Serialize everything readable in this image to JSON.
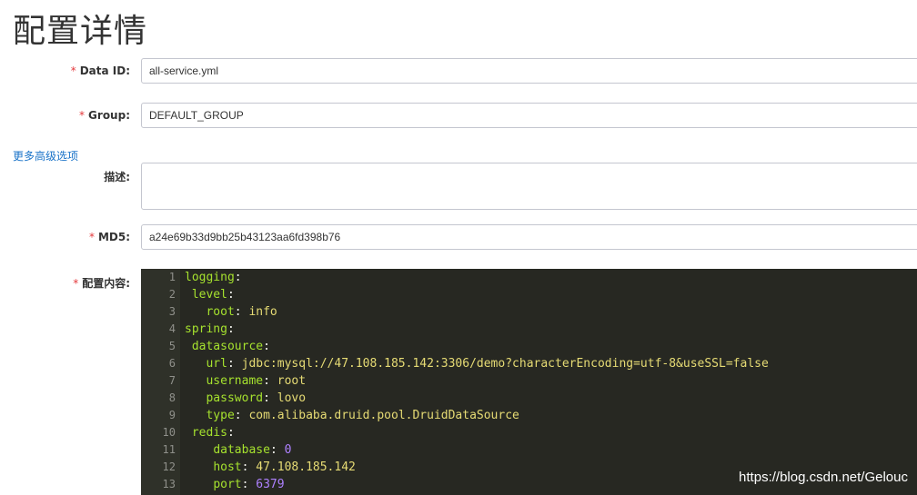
{
  "page": {
    "title": "配置详情"
  },
  "form": {
    "data_id": {
      "label": "Data ID:",
      "value": "all-service.yml"
    },
    "group": {
      "label": "Group:",
      "value": "DEFAULT_GROUP"
    },
    "advanced_link": "更多高级选项",
    "description": {
      "label": "描述:",
      "value": ""
    },
    "md5": {
      "label": "MD5:",
      "value": "a24e69b33d9bb25b43123aa6fd398b76"
    },
    "content": {
      "label": "配置内容:"
    },
    "required_mark": "*"
  },
  "editor": {
    "lines": [
      {
        "n": "1",
        "indent": "",
        "key": "logging",
        "value": "",
        "value_type": ""
      },
      {
        "n": "2",
        "indent": " ",
        "key": "level",
        "value": "",
        "value_type": ""
      },
      {
        "n": "3",
        "indent": "   ",
        "key": "root",
        "value": "info",
        "value_type": "str"
      },
      {
        "n": "4",
        "indent": "",
        "key": "spring",
        "value": "",
        "value_type": ""
      },
      {
        "n": "5",
        "indent": " ",
        "key": "datasource",
        "value": "",
        "value_type": ""
      },
      {
        "n": "6",
        "indent": "   ",
        "key": "url",
        "value": "jdbc:mysql://47.108.185.142:3306/demo?characterEncoding=utf-8&useSSL=false",
        "value_type": "str"
      },
      {
        "n": "7",
        "indent": "   ",
        "key": "username",
        "value": "root",
        "value_type": "str"
      },
      {
        "n": "8",
        "indent": "   ",
        "key": "password",
        "value": "lovo",
        "value_type": "str"
      },
      {
        "n": "9",
        "indent": "   ",
        "key": "type",
        "value": "com.alibaba.druid.pool.DruidDataSource",
        "value_type": "str"
      },
      {
        "n": "10",
        "indent": " ",
        "key": "redis",
        "value": "",
        "value_type": ""
      },
      {
        "n": "11",
        "indent": "    ",
        "key": "database",
        "value": "0",
        "value_type": "num"
      },
      {
        "n": "12",
        "indent": "    ",
        "key": "host",
        "value": "47.108.185.142",
        "value_type": "str"
      },
      {
        "n": "13",
        "indent": "    ",
        "key": "port",
        "value": "6379",
        "value_type": "num"
      }
    ],
    "colors": {
      "background": "#272822",
      "key": "#a6e22e",
      "string": "#e6db74",
      "number": "#ae81ff",
      "gutter_text": "#8f908a"
    }
  },
  "watermark": "https://blog.csdn.net/Gelouc"
}
